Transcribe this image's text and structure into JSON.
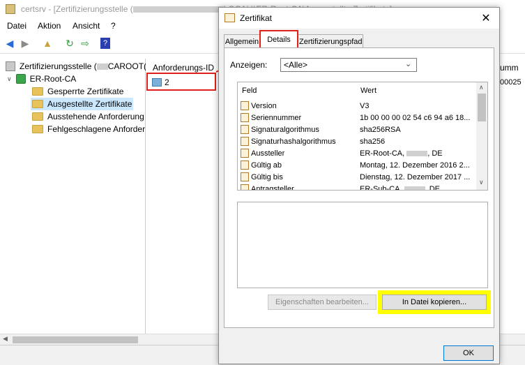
{
  "main_window": {
    "title": "certsrv - [Zertifizierungsstelle (",
    "title_suffix": "LOCAL)\\ER-Root-CA\\Ausgestellte Zertifikate]",
    "menu": [
      "Datei",
      "Aktion",
      "Ansicht",
      "?"
    ],
    "tree": {
      "root": "Zertifizierungsstelle (",
      "root_suffix": "CAROOT(",
      "ca": "ER-Root-CA",
      "folders": [
        "Gesperrte Zertifikate",
        "Ausgestellte Zertifikate",
        "Ausstehende Anforderung",
        "Fehlgeschlagene Anforder"
      ]
    },
    "list": {
      "column_header": "Anforderungs-ID",
      "right_header_fragment": "umm",
      "row_id": "2",
      "right_value_fragment": "00025"
    }
  },
  "dialog": {
    "title": "Zertifikat",
    "tabs": [
      "Allgemein",
      "Details",
      "Zertifizierungspfad"
    ],
    "show_label": "Anzeigen:",
    "show_value": "<Alle>",
    "columns": {
      "field": "Feld",
      "value": "Wert"
    },
    "rows": [
      {
        "field": "Version",
        "value": "V3"
      },
      {
        "field": "Seriennummer",
        "value": "1b 00 00 00 02 54 c6 94 a6 18..."
      },
      {
        "field": "Signaturalgorithmus",
        "value": "sha256RSA"
      },
      {
        "field": "Signaturhashalgorithmus",
        "value": "sha256"
      },
      {
        "field": "Aussteller",
        "value": "ER-Root-CA, ",
        "value_suffix": ", DE"
      },
      {
        "field": "Gültig ab",
        "value": "Montag, 12. Dezember 2016 2..."
      },
      {
        "field": "Gültig bis",
        "value": "Dienstag, 12. Dezember 2017 ..."
      },
      {
        "field": "Antragsteller",
        "value": "ER-Sub-CA, ",
        "value_suffix": ", DE"
      }
    ],
    "buttons": {
      "edit_properties": "Eigenschaften bearbeiten...",
      "copy_to_file": "In Datei kopieren...",
      "ok": "OK"
    }
  },
  "colors": {
    "highlight_yellow": "#ffff00",
    "annotation_red": "#e0201a",
    "selection": "#cce8ff"
  }
}
